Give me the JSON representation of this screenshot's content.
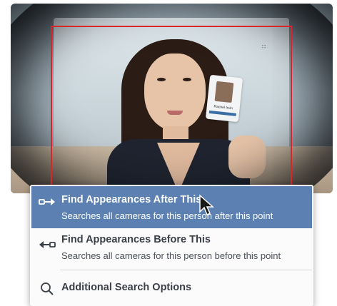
{
  "video": {
    "id_card_name": "Rachel Irsin"
  },
  "menu": {
    "items": [
      {
        "title": "Find Appearances After This",
        "subtitle": "Searches all cameras for this person after this point",
        "icon": "arrow-right-icon",
        "active": true
      },
      {
        "title": "Find Appearances Before This",
        "subtitle": "Searches all cameras for this person before this point",
        "icon": "arrow-left-icon",
        "active": false
      },
      {
        "title": "Additional Search Options",
        "icon": "search-icon",
        "active": false
      }
    ]
  },
  "colors": {
    "highlight": "#5b80b1",
    "detection_box": "#d9262b",
    "menu_text": "#3a3f47"
  }
}
